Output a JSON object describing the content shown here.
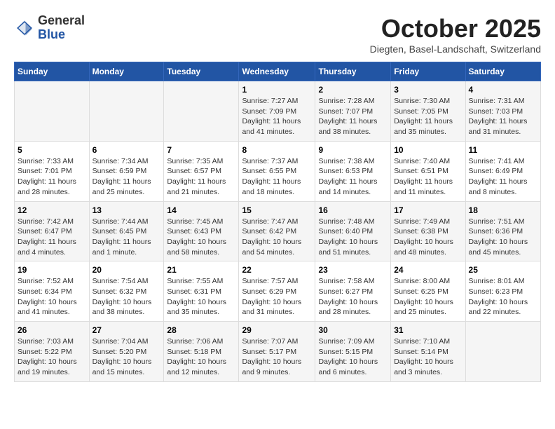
{
  "header": {
    "logo_general": "General",
    "logo_blue": "Blue",
    "month": "October 2025",
    "location": "Diegten, Basel-Landschaft, Switzerland"
  },
  "days_of_week": [
    "Sunday",
    "Monday",
    "Tuesday",
    "Wednesday",
    "Thursday",
    "Friday",
    "Saturday"
  ],
  "weeks": [
    [
      {
        "day": "",
        "info": ""
      },
      {
        "day": "",
        "info": ""
      },
      {
        "day": "",
        "info": ""
      },
      {
        "day": "1",
        "info": "Sunrise: 7:27 AM\nSunset: 7:09 PM\nDaylight: 11 hours and 41 minutes."
      },
      {
        "day": "2",
        "info": "Sunrise: 7:28 AM\nSunset: 7:07 PM\nDaylight: 11 hours and 38 minutes."
      },
      {
        "day": "3",
        "info": "Sunrise: 7:30 AM\nSunset: 7:05 PM\nDaylight: 11 hours and 35 minutes."
      },
      {
        "day": "4",
        "info": "Sunrise: 7:31 AM\nSunset: 7:03 PM\nDaylight: 11 hours and 31 minutes."
      }
    ],
    [
      {
        "day": "5",
        "info": "Sunrise: 7:33 AM\nSunset: 7:01 PM\nDaylight: 11 hours and 28 minutes."
      },
      {
        "day": "6",
        "info": "Sunrise: 7:34 AM\nSunset: 6:59 PM\nDaylight: 11 hours and 25 minutes."
      },
      {
        "day": "7",
        "info": "Sunrise: 7:35 AM\nSunset: 6:57 PM\nDaylight: 11 hours and 21 minutes."
      },
      {
        "day": "8",
        "info": "Sunrise: 7:37 AM\nSunset: 6:55 PM\nDaylight: 11 hours and 18 minutes."
      },
      {
        "day": "9",
        "info": "Sunrise: 7:38 AM\nSunset: 6:53 PM\nDaylight: 11 hours and 14 minutes."
      },
      {
        "day": "10",
        "info": "Sunrise: 7:40 AM\nSunset: 6:51 PM\nDaylight: 11 hours and 11 minutes."
      },
      {
        "day": "11",
        "info": "Sunrise: 7:41 AM\nSunset: 6:49 PM\nDaylight: 11 hours and 8 minutes."
      }
    ],
    [
      {
        "day": "12",
        "info": "Sunrise: 7:42 AM\nSunset: 6:47 PM\nDaylight: 11 hours and 4 minutes."
      },
      {
        "day": "13",
        "info": "Sunrise: 7:44 AM\nSunset: 6:45 PM\nDaylight: 11 hours and 1 minute."
      },
      {
        "day": "14",
        "info": "Sunrise: 7:45 AM\nSunset: 6:43 PM\nDaylight: 10 hours and 58 minutes."
      },
      {
        "day": "15",
        "info": "Sunrise: 7:47 AM\nSunset: 6:42 PM\nDaylight: 10 hours and 54 minutes."
      },
      {
        "day": "16",
        "info": "Sunrise: 7:48 AM\nSunset: 6:40 PM\nDaylight: 10 hours and 51 minutes."
      },
      {
        "day": "17",
        "info": "Sunrise: 7:49 AM\nSunset: 6:38 PM\nDaylight: 10 hours and 48 minutes."
      },
      {
        "day": "18",
        "info": "Sunrise: 7:51 AM\nSunset: 6:36 PM\nDaylight: 10 hours and 45 minutes."
      }
    ],
    [
      {
        "day": "19",
        "info": "Sunrise: 7:52 AM\nSunset: 6:34 PM\nDaylight: 10 hours and 41 minutes."
      },
      {
        "day": "20",
        "info": "Sunrise: 7:54 AM\nSunset: 6:32 PM\nDaylight: 10 hours and 38 minutes."
      },
      {
        "day": "21",
        "info": "Sunrise: 7:55 AM\nSunset: 6:31 PM\nDaylight: 10 hours and 35 minutes."
      },
      {
        "day": "22",
        "info": "Sunrise: 7:57 AM\nSunset: 6:29 PM\nDaylight: 10 hours and 31 minutes."
      },
      {
        "day": "23",
        "info": "Sunrise: 7:58 AM\nSunset: 6:27 PM\nDaylight: 10 hours and 28 minutes."
      },
      {
        "day": "24",
        "info": "Sunrise: 8:00 AM\nSunset: 6:25 PM\nDaylight: 10 hours and 25 minutes."
      },
      {
        "day": "25",
        "info": "Sunrise: 8:01 AM\nSunset: 6:23 PM\nDaylight: 10 hours and 22 minutes."
      }
    ],
    [
      {
        "day": "26",
        "info": "Sunrise: 7:03 AM\nSunset: 5:22 PM\nDaylight: 10 hours and 19 minutes."
      },
      {
        "day": "27",
        "info": "Sunrise: 7:04 AM\nSunset: 5:20 PM\nDaylight: 10 hours and 15 minutes."
      },
      {
        "day": "28",
        "info": "Sunrise: 7:06 AM\nSunset: 5:18 PM\nDaylight: 10 hours and 12 minutes."
      },
      {
        "day": "29",
        "info": "Sunrise: 7:07 AM\nSunset: 5:17 PM\nDaylight: 10 hours and 9 minutes."
      },
      {
        "day": "30",
        "info": "Sunrise: 7:09 AM\nSunset: 5:15 PM\nDaylight: 10 hours and 6 minutes."
      },
      {
        "day": "31",
        "info": "Sunrise: 7:10 AM\nSunset: 5:14 PM\nDaylight: 10 hours and 3 minutes."
      },
      {
        "day": "",
        "info": ""
      }
    ]
  ]
}
